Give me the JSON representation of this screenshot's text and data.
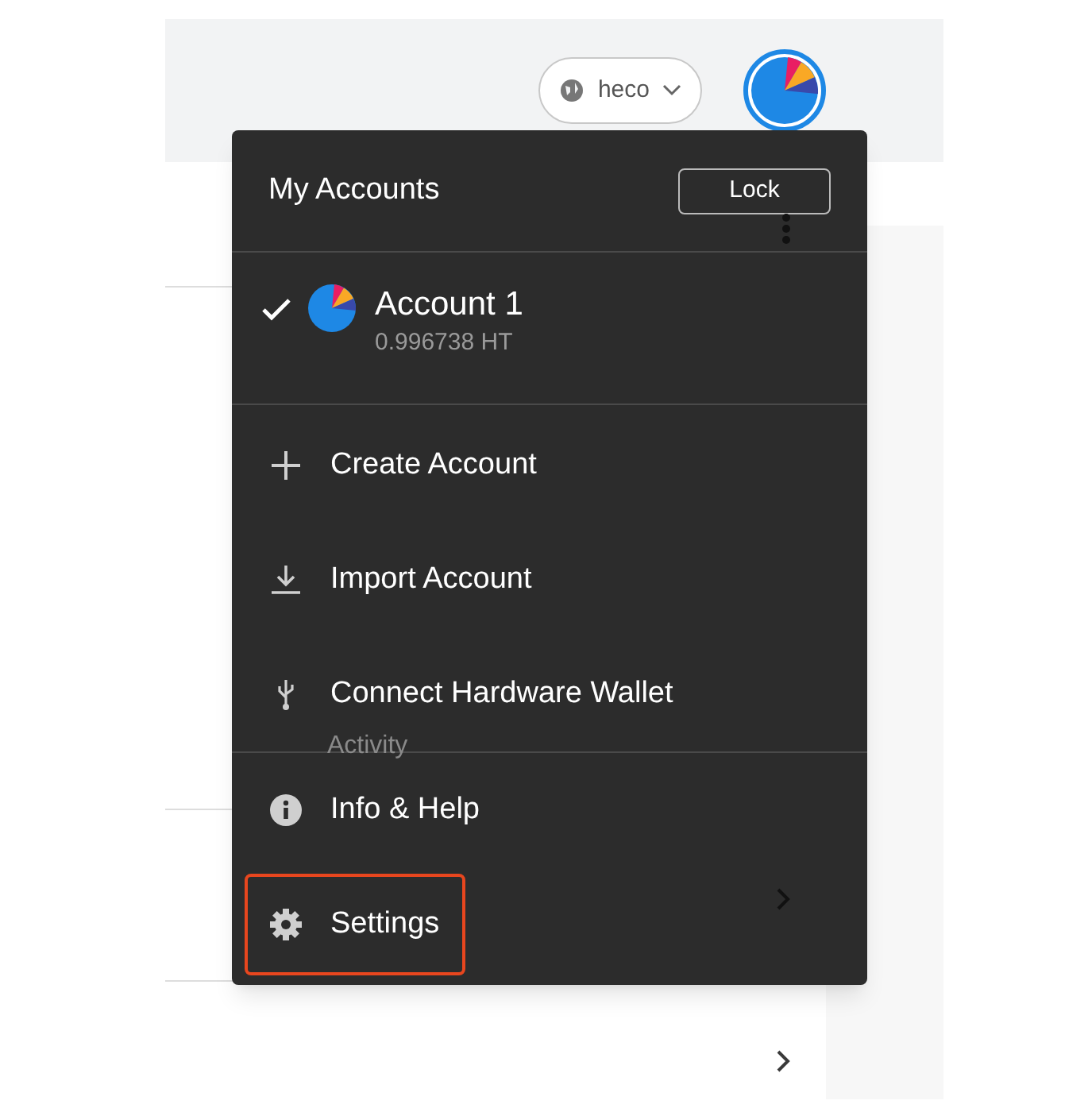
{
  "network": {
    "label": "heco"
  },
  "menu": {
    "title": "My Accounts",
    "lock_button": "Lock",
    "accounts": [
      {
        "name": "Account 1",
        "balance": "0.996738 HT",
        "selected": true
      }
    ],
    "items": [
      {
        "kind": "create",
        "label": "Create Account",
        "highlighted": false
      },
      {
        "kind": "import",
        "label": "Import Account",
        "highlighted": false
      },
      {
        "kind": "hardware",
        "label": "Connect Hardware Wallet",
        "highlighted": false
      },
      {
        "kind": "info",
        "label": "Info & Help",
        "highlighted": false
      },
      {
        "kind": "settings",
        "label": "Settings",
        "highlighted": true
      }
    ]
  },
  "background_tab": "Activity"
}
